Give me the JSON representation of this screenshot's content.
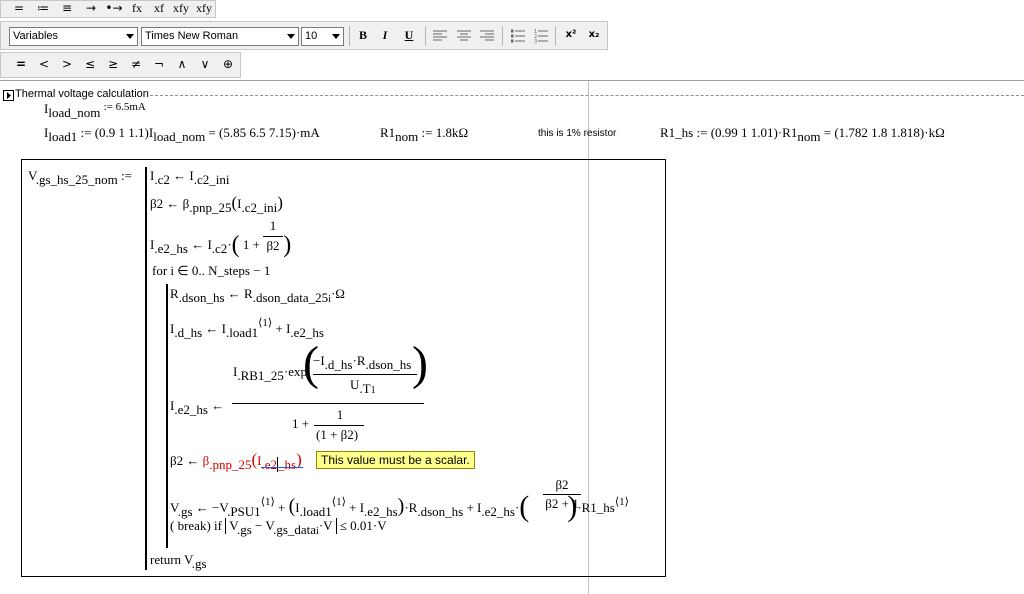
{
  "toolbar1": {
    "buttons": [
      "=",
      "≔",
      "≡",
      "→",
      "•→",
      "fx",
      "xf",
      "xfy",
      "xfy"
    ]
  },
  "toolbar2": {
    "style_value": "Variables",
    "font_value": "Times New Roman",
    "size_value": "10",
    "bold": "B",
    "italic": "I",
    "underline": "U",
    "superscript": "x²",
    "subscript": "x₂"
  },
  "toolbar3": {
    "buttons": [
      "=",
      "<",
      ">",
      "≤",
      "≥",
      "≠",
      "¬",
      "∧",
      "∨",
      "⊕"
    ]
  },
  "region": {
    "title": "Thermal voltage calculation"
  },
  "top": {
    "iload_nom_text": "6.5mA",
    "iload1_vec": "(0.9  1  1.1)",
    "iload1_result": "(5.85  6.5  7.15)·mA",
    "r1nom_value": "1.8kΩ",
    "note": "this is 1% resistor",
    "r1hs_vec": "(0.99  1  1.01)·R1",
    "r1hs_result": "(1.782  1.8  1.818)·kΩ"
  },
  "tooltip": {
    "text": "This value must be a scalar."
  },
  "program": {
    "name": "V",
    "name_sub": ".gs_hs_25_nom",
    "for_line": "for  i ∈ 0.. N_steps − 1",
    "break_line": "( break)  if",
    "return_line": "return  V",
    "return_sub": ".gs"
  }
}
